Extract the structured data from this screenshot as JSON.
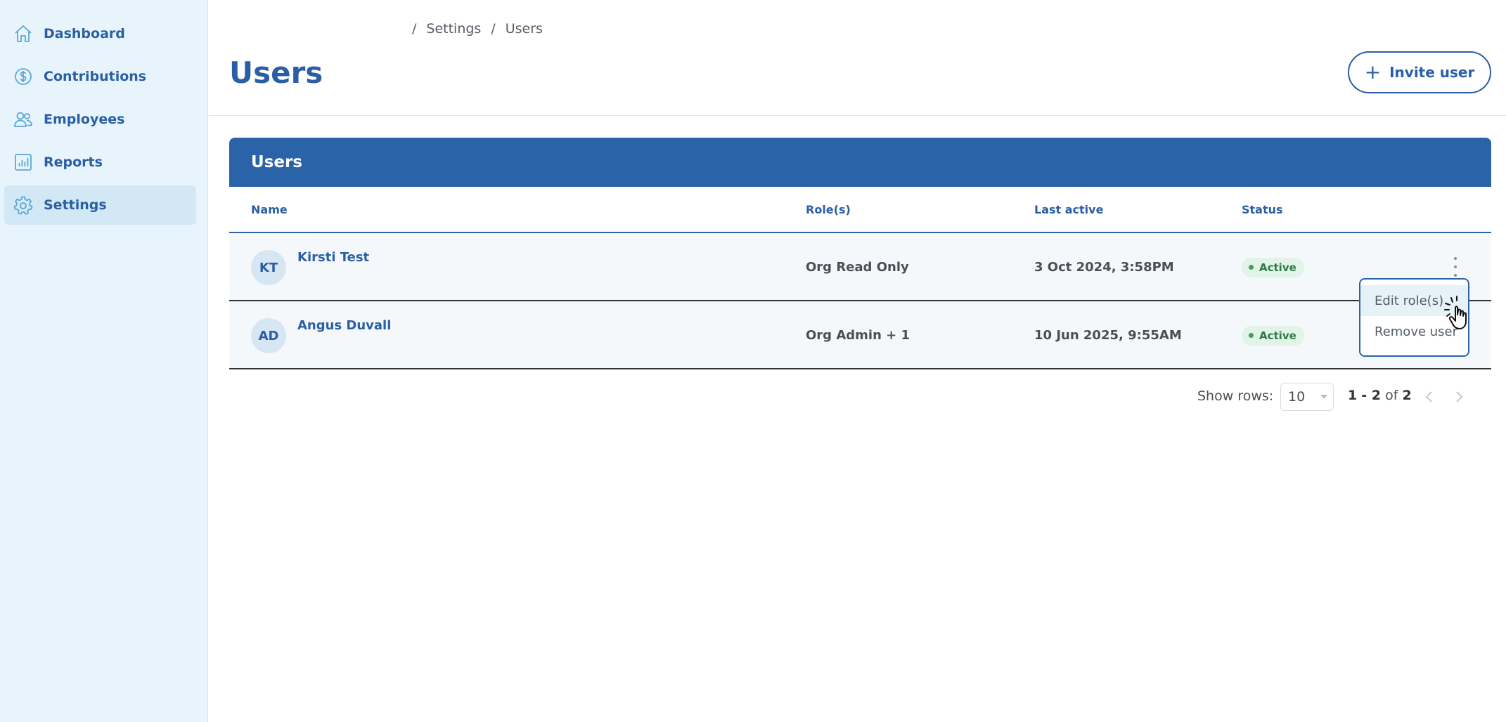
{
  "sidebar": {
    "items": [
      {
        "label": "Dashboard",
        "icon": "home-icon"
      },
      {
        "label": "Contributions",
        "icon": "dollar-icon"
      },
      {
        "label": "Employees",
        "icon": "people-icon"
      },
      {
        "label": "Reports",
        "icon": "chart-icon"
      },
      {
        "label": "Settings",
        "icon": "gear-icon",
        "active": true
      }
    ]
  },
  "breadcrumb": {
    "sep": "/",
    "items": [
      "Settings",
      "Users"
    ]
  },
  "page": {
    "title": "Users",
    "invite_label": "Invite user"
  },
  "table": {
    "title": "Users",
    "columns": {
      "name": "Name",
      "roles": "Role(s)",
      "last_active": "Last active",
      "status": "Status"
    },
    "rows": [
      {
        "initials": "KT",
        "name": "Kirsti Test",
        "roles": "Org Read Only",
        "last_active": "3 Oct 2024, 3:58PM",
        "status": "Active"
      },
      {
        "initials": "AD",
        "name": "Angus Duvall",
        "roles": "Org Admin + 1",
        "last_active": "10 Jun 2025, 9:55AM",
        "status": "Active"
      }
    ]
  },
  "menu": {
    "edit_label": "Edit role(s)",
    "remove_label": "Remove user"
  },
  "pagination": {
    "show_rows_label": "Show rows:",
    "rows_value": "10",
    "range_start": "1",
    "range_end": "2",
    "range_of": "of",
    "total": "2"
  },
  "colors": {
    "primary": "#2b63a8",
    "sidebar_bg": "#e8f4fb",
    "active_badge_bg": "#e2f3e7",
    "active_badge_text": "#2f7a45"
  }
}
